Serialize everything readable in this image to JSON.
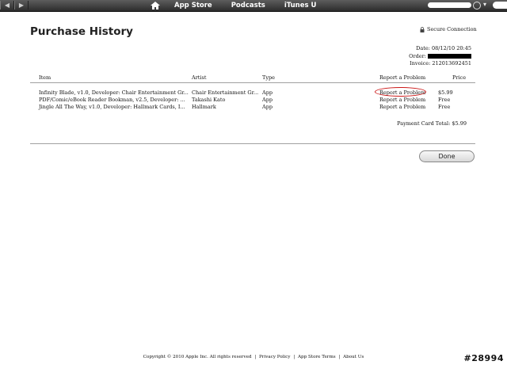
{
  "toolbar": {
    "back_icon": "left-arrow-icon",
    "forward_icon": "right-arrow-icon",
    "home_icon": "home-icon",
    "tabs": [
      {
        "label": "App Store"
      },
      {
        "label": "Podcasts"
      },
      {
        "label": "iTunes U"
      }
    ]
  },
  "page": {
    "title": "Purchase History",
    "secure_label": "Secure Connection",
    "date_label": "Date:",
    "date_value": "08/12/10 20:45",
    "order_label": "Order:",
    "invoice_label": "Invoice:",
    "invoice_value": "212013692451"
  },
  "table": {
    "headers": {
      "item": "Item",
      "artist": "Artist",
      "type": "Type",
      "report": "Report a Problem",
      "price": "Price"
    },
    "rows": [
      {
        "item": "Infinity Blade, v1.0, Developer: Chair Entertainment Gr...",
        "artist": "Chair Entertainment Gr...",
        "type": "App",
        "report": "Report a Problem",
        "price": "$5.99"
      },
      {
        "item": "PDF/Comic/eBook Reader Bookman, v2.5, Developer: ...",
        "artist": "Takashi Kato",
        "type": "App",
        "report": "Report a Problem",
        "price": "Free"
      },
      {
        "item": "Jingle All The Way, v1.0, Developer: Hallmark Cards, I...",
        "artist": "Hallmark",
        "type": "App",
        "report": "Report a Problem",
        "price": "Free"
      }
    ],
    "total_label": "Payment Card Total:",
    "total_value": "$5.99"
  },
  "done_label": "Done",
  "footer": {
    "copyright": "Copyright © 2010 Apple Inc. All rights reserved",
    "separator": "|",
    "privacy": "Privacy Policy",
    "terms": "App Store Terms",
    "about": "About Us"
  },
  "watermark": "#28994",
  "colors": {
    "highlight_circle": "#cc1818",
    "toolbar": "#3a3a3a"
  }
}
